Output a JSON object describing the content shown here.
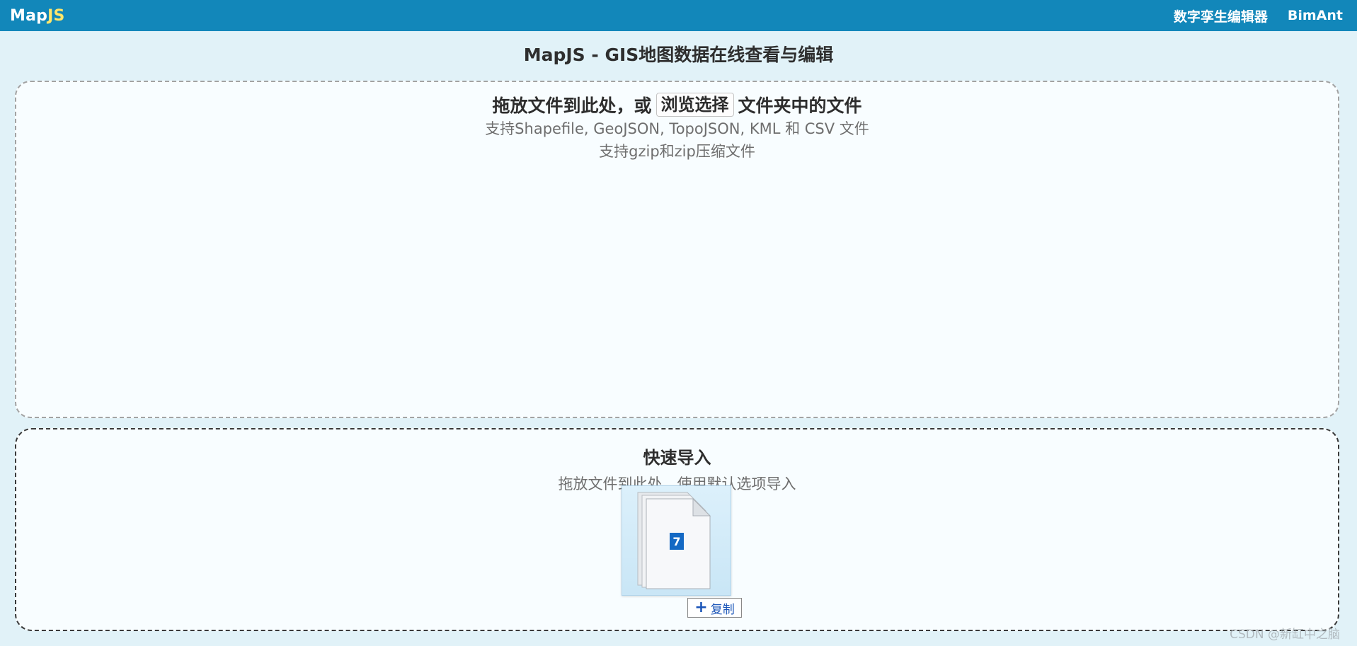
{
  "navbar": {
    "brand_part1": "Map",
    "brand_part2": "JS",
    "links": [
      {
        "label": "数字孪生编辑器"
      },
      {
        "label": "BimAnt"
      }
    ],
    "background_color": "#1287ba",
    "brand_accent_color": "#ffe66b"
  },
  "page": {
    "heading": "MapJS - GIS地图数据在线查看与编辑"
  },
  "dropzone": {
    "title_before": "拖放文件到此处，或",
    "browse_label": "浏览选择",
    "title_after": "文件夹中的文件",
    "formats_line": "支持Shapefile, GeoJSON, TopoJSON, KML 和 CSV 文件",
    "compress_line": "支持gzip和zip压缩文件"
  },
  "quick_import": {
    "title": "快速导入",
    "description": "拖放文件到此处，使用默认选项导入"
  },
  "drag_feedback": {
    "file_count": "7",
    "copy_label": "复制",
    "icon": "file-stack-icon"
  },
  "watermark": {
    "text": "CSDN @新缸中之脑"
  }
}
